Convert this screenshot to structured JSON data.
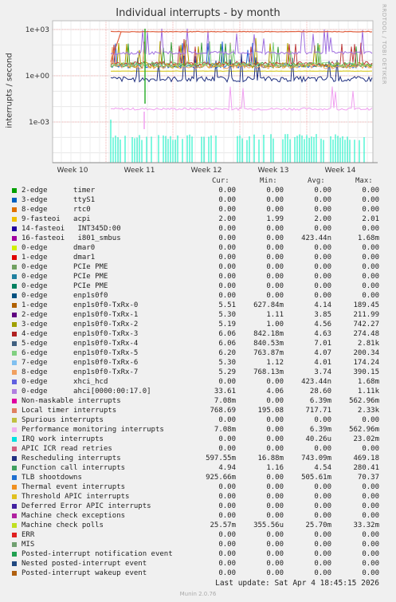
{
  "title": "Individual interrupts - by month",
  "side_label": "RRDTOOL / TOBI OETIKER",
  "ylabel": "interrupts / second",
  "columns": {
    "cur": "Cur:",
    "min": "Min:",
    "avg": "Avg:",
    "max": "Max:"
  },
  "last_update": "Last update: Sat Apr  4 18:45:15 2026",
  "footer": "Munin 2.0.76",
  "chart_data": {
    "type": "line",
    "title": "Individual interrupts - by month",
    "ylabel": "interrupts / second",
    "y_scale": "log",
    "y_ticks": [
      "1e+03",
      "1e+00",
      "1e-03"
    ],
    "x_ticks": [
      "Week 10",
      "Week 11",
      "Week 12",
      "Week 13",
      "Week 14"
    ],
    "grid": true,
    "series_levels": [
      {
        "name": "Local timer interrupts",
        "color": "#e06040",
        "level": 768.69
      },
      {
        "name": "ahci[0000:00:17.0]",
        "color": "#a070e0",
        "level": 33.61
      },
      {
        "name": "enp1s0f0-TxRx-3",
        "color": "#c04040",
        "level": 6.06
      },
      {
        "name": "enp1s0f0-TxRx-5",
        "color": "#9fd060",
        "level": 6.2
      },
      {
        "name": "Function call interrupts",
        "color": "#2060c0",
        "level": 4.94
      },
      {
        "name": "acpi",
        "color": "#d0c000",
        "level": 2.0
      },
      {
        "name": "Rescheduling interrupts",
        "color": "#204080",
        "level": 0.598
      },
      {
        "name": "Performance monitoring interrupts",
        "color": "#f090f0",
        "level": 0.00708
      },
      {
        "name": "IRQ work interrupts",
        "color": "#00e0c0",
        "level": 4.02e-05
      }
    ]
  },
  "legend": [
    {
      "color": "#00a000",
      "name": "2-edge      timer",
      "cur": "0.00",
      "min": "0.00",
      "avg": "0.00",
      "max": "0.00"
    },
    {
      "color": "#0060c0",
      "name": "3-edge      ttyS1",
      "cur": "0.00",
      "min": "0.00",
      "avg": "0.00",
      "max": "0.00"
    },
    {
      "color": "#e07000",
      "name": "8-edge      rtc0",
      "cur": "0.00",
      "min": "0.00",
      "avg": "0.00",
      "max": "0.00"
    },
    {
      "color": "#f0c000",
      "name": "9-fasteoi   acpi",
      "cur": "2.00",
      "min": "1.99",
      "avg": "2.00",
      "max": "2.01"
    },
    {
      "color": "#2000a0",
      "name": "14-fasteoi   INT345D:00",
      "cur": "0.00",
      "min": "0.00",
      "avg": "0.00",
      "max": "0.00"
    },
    {
      "color": "#a000a0",
      "name": "16-fasteoi   i801_smbus",
      "cur": "0.00",
      "min": "0.00",
      "avg": "423.44n",
      "max": "1.68m"
    },
    {
      "color": "#d0f000",
      "name": "0-edge      dmar0",
      "cur": "0.00",
      "min": "0.00",
      "avg": "0.00",
      "max": "0.00"
    },
    {
      "color": "#e00000",
      "name": "1-edge      dmar1",
      "cur": "0.00",
      "min": "0.00",
      "avg": "0.00",
      "max": "0.00"
    },
    {
      "color": "#70a060",
      "name": "0-edge      PCIe PME",
      "cur": "0.00",
      "min": "0.00",
      "avg": "0.00",
      "max": "0.00"
    },
    {
      "color": "#2080a0",
      "name": "0-edge      PCIe PME",
      "cur": "0.00",
      "min": "0.00",
      "avg": "0.00",
      "max": "0.00"
    },
    {
      "color": "#008060",
      "name": "0-edge      PCIe PME",
      "cur": "0.00",
      "min": "0.00",
      "avg": "0.00",
      "max": "0.00"
    },
    {
      "color": "#005080",
      "name": "0-edge      enp1s0f0",
      "cur": "0.00",
      "min": "0.00",
      "avg": "0.00",
      "max": "0.00"
    },
    {
      "color": "#b06000",
      "name": "1-edge      enp1s0f0-TxRx-0",
      "cur": "5.51",
      "min": "627.84m",
      "avg": "4.14",
      "max": "189.45"
    },
    {
      "color": "#600080",
      "name": "2-edge      enp1s0f0-TxRx-1",
      "cur": "5.30",
      "min": "1.11",
      "avg": "3.85",
      "max": "211.99"
    },
    {
      "color": "#a0a000",
      "name": "3-edge      enp1s0f0-TxRx-2",
      "cur": "5.19",
      "min": "1.00",
      "avg": "4.56",
      "max": "742.27"
    },
    {
      "color": "#b02020",
      "name": "4-edge      enp1s0f0-TxRx-3",
      "cur": "6.06",
      "min": "842.18m",
      "avg": "4.63",
      "max": "274.48"
    },
    {
      "color": "#406080",
      "name": "5-edge      enp1s0f0-TxRx-4",
      "cur": "6.06",
      "min": "840.53m",
      "avg": "7.01",
      "max": "2.81k"
    },
    {
      "color": "#80d080",
      "name": "6-edge      enp1s0f0-TxRx-5",
      "cur": "6.20",
      "min": "763.87m",
      "avg": "4.07",
      "max": "200.34"
    },
    {
      "color": "#80c0f0",
      "name": "7-edge      enp1s0f0-TxRx-6",
      "cur": "5.30",
      "min": "1.12",
      "avg": "4.01",
      "max": "174.24"
    },
    {
      "color": "#f0a060",
      "name": "8-edge      enp1s0f0-TxRx-7",
      "cur": "5.29",
      "min": "768.13m",
      "avg": "3.74",
      "max": "390.15"
    },
    {
      "color": "#6060e0",
      "name": "0-edge      xhci_hcd",
      "cur": "0.00",
      "min": "0.00",
      "avg": "423.44n",
      "max": "1.68m"
    },
    {
      "color": "#b080e0",
      "name": "0-edge      ahci[0000:00:17.0]",
      "cur": "33.61",
      "min": "4.06",
      "avg": "28.60",
      "max": "1.11k"
    },
    {
      "color": "#e000a0",
      "name": "Non-maskable interrupts",
      "cur": "7.08m",
      "min": "0.00",
      "avg": "6.39m",
      "max": "562.96m"
    },
    {
      "color": "#e08060",
      "name": "Local timer interrupts",
      "cur": "768.69",
      "min": "195.08",
      "avg": "717.71",
      "max": "2.33k"
    },
    {
      "color": "#c0c040",
      "name": "Spurious interrupts",
      "cur": "0.00",
      "min": "0.00",
      "avg": "0.00",
      "max": "0.00"
    },
    {
      "color": "#f0b0f0",
      "name": "Performance monitoring interrupts",
      "cur": "7.08m",
      "min": "0.00",
      "avg": "6.39m",
      "max": "562.96m"
    },
    {
      "color": "#00e0e0",
      "name": "IRQ work interrupts",
      "cur": "0.00",
      "min": "0.00",
      "avg": "40.26u",
      "max": "23.02m"
    },
    {
      "color": "#d06080",
      "name": "APIC ICR read retries",
      "cur": "0.00",
      "min": "0.00",
      "avg": "0.00",
      "max": "0.00"
    },
    {
      "color": "#203080",
      "name": "Rescheduling interrupts",
      "cur": "597.55m",
      "min": "16.88m",
      "avg": "743.09m",
      "max": "469.18"
    },
    {
      "color": "#40a060",
      "name": "Function call interrupts",
      "cur": "4.94",
      "min": "1.16",
      "avg": "4.54",
      "max": "280.41"
    },
    {
      "color": "#2070d0",
      "name": "TLB shootdowns",
      "cur": "925.66m",
      "min": "0.00",
      "avg": "505.61m",
      "max": "70.37"
    },
    {
      "color": "#f09020",
      "name": "Thermal event interrupts",
      "cur": "0.00",
      "min": "0.00",
      "avg": "0.00",
      "max": "0.00"
    },
    {
      "color": "#e0c020",
      "name": "Threshold APIC interrupts",
      "cur": "0.00",
      "min": "0.00",
      "avg": "0.00",
      "max": "0.00"
    },
    {
      "color": "#4020a0",
      "name": "Deferred Error APIC interrupts",
      "cur": "0.00",
      "min": "0.00",
      "avg": "0.00",
      "max": "0.00"
    },
    {
      "color": "#b020a0",
      "name": "Machine check exceptions",
      "cur": "0.00",
      "min": "0.00",
      "avg": "0.00",
      "max": "0.00"
    },
    {
      "color": "#c0e020",
      "name": "Machine check polls",
      "cur": "25.57m",
      "min": "355.56u",
      "avg": "25.70m",
      "max": "33.32m"
    },
    {
      "color": "#e02020",
      "name": "ERR",
      "cur": "0.00",
      "min": "0.00",
      "avg": "0.00",
      "max": "0.00"
    },
    {
      "color": "#70a070",
      "name": "MIS",
      "cur": "0.00",
      "min": "0.00",
      "avg": "0.00",
      "max": "0.00"
    },
    {
      "color": "#20a050",
      "name": "Posted-interrupt notification event",
      "cur": "0.00",
      "min": "0.00",
      "avg": "0.00",
      "max": "0.00"
    },
    {
      "color": "#204880",
      "name": "Nested posted-interrupt event",
      "cur": "0.00",
      "min": "0.00",
      "avg": "0.00",
      "max": "0.00"
    },
    {
      "color": "#b06010",
      "name": "Posted-interrupt wakeup event",
      "cur": "0.00",
      "min": "0.00",
      "avg": "0.00",
      "max": "0.00"
    }
  ]
}
